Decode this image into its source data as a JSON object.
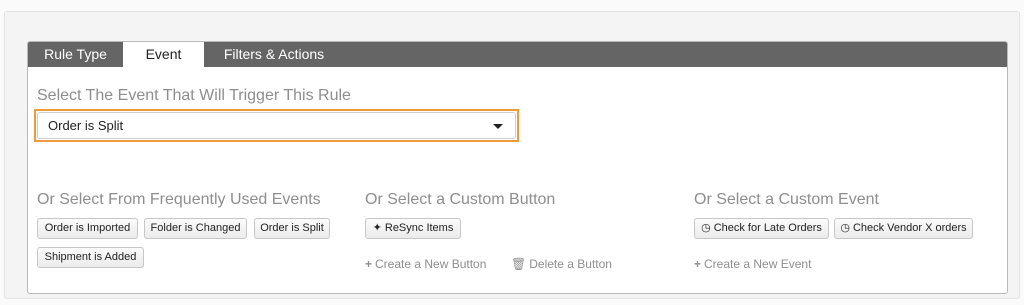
{
  "tabs": [
    {
      "label": "Rule Type"
    },
    {
      "label": "Event"
    },
    {
      "label": "Filters & Actions"
    }
  ],
  "trigger": {
    "title": "Select The Event That Will Trigger This Rule",
    "selected": "Order is Split"
  },
  "frequent": {
    "title": "Or Select From Frequently Used Events",
    "buttons": [
      {
        "label": "Order is Imported"
      },
      {
        "label": "Folder is Changed"
      },
      {
        "label": "Order is Split"
      },
      {
        "label": "Shipment is Added"
      }
    ]
  },
  "custom_button": {
    "title": "Or Select a Custom Button",
    "buttons": [
      {
        "label": "ReSync Items",
        "icon": "magic-wand-icon"
      }
    ],
    "create_label": "Create a New Button",
    "delete_label": "Delete a Button"
  },
  "custom_event": {
    "title": "Or Select a Custom Event",
    "buttons": [
      {
        "label": "Check for Late Orders",
        "icon": "clock-icon"
      },
      {
        "label": "Check Vendor X orders",
        "icon": "clock-icon"
      }
    ],
    "create_label": "Create a New Event"
  },
  "colors": {
    "tab_bar": "#656565",
    "highlight": "#ee9b3e",
    "muted_text": "#8e8e8e"
  }
}
